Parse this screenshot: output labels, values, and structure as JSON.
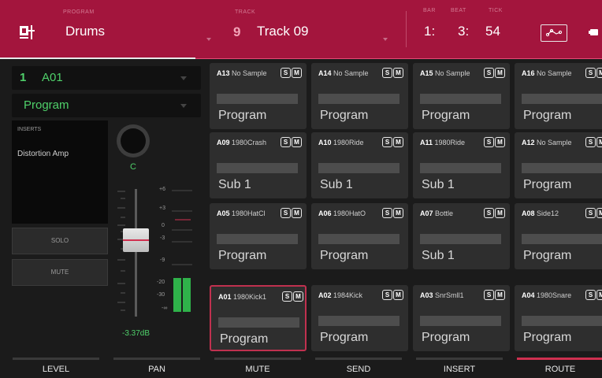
{
  "header": {
    "program_label": "PROGRAM",
    "program_name": "Drums",
    "track_label": "TRACK",
    "track_number": "9",
    "track_name": "Track 09",
    "bar_label": "BAR",
    "beat_label": "BEAT",
    "tick_label": "TICK",
    "bar": "1:",
    "beat": "3:",
    "tick": "54"
  },
  "left_panel": {
    "pad_select": {
      "number": "1",
      "name": "A01"
    },
    "mode_select": "Program",
    "inserts_label": "INSERTS",
    "insert_1": "Distortion Amp",
    "pan_value": "C",
    "solo_label": "SOLO",
    "mute_label": "MUTE",
    "fader_scale": [
      "+6",
      "+3",
      "0",
      "-3",
      "-9",
      "-20",
      "-30",
      "-∞"
    ],
    "level_db": "-3.37dB",
    "fader_level_db": -3.37,
    "meter_levels": [
      0.55,
      0.55
    ]
  },
  "pads": [
    {
      "id": "A13",
      "name": "No Sample",
      "type": "Program",
      "s": "S",
      "m": "M"
    },
    {
      "id": "A14",
      "name": "No Sample",
      "type": "Program",
      "s": "S",
      "m": "M"
    },
    {
      "id": "A15",
      "name": "No Sample",
      "type": "Program",
      "s": "S",
      "m": "M"
    },
    {
      "id": "A16",
      "name": "No Sample",
      "type": "Program",
      "s": "S",
      "m": "M"
    },
    {
      "id": "A09",
      "name": "1980Crash",
      "type": "Sub 1",
      "s": "S",
      "m": "M"
    },
    {
      "id": "A10",
      "name": "1980Ride",
      "type": "Sub 1",
      "s": "S",
      "m": "M"
    },
    {
      "id": "A11",
      "name": "1980Ride",
      "type": "Sub 1",
      "s": "S",
      "m": "M"
    },
    {
      "id": "A12",
      "name": "No Sample",
      "type": "Program",
      "s": "S",
      "m": "M"
    },
    {
      "id": "A05",
      "name": "1980HatCl",
      "type": "Program",
      "s": "S",
      "m": "M"
    },
    {
      "id": "A06",
      "name": "1980HatO",
      "type": "Program",
      "s": "S",
      "m": "M"
    },
    {
      "id": "A07",
      "name": "Bottle",
      "type": "Sub 1",
      "s": "S",
      "m": "M"
    },
    {
      "id": "A08",
      "name": "Side12",
      "type": "Program",
      "s": "S",
      "m": "M"
    },
    {
      "id": "A01",
      "name": "1980Kick1",
      "type": "Program",
      "s": "S",
      "m": "M",
      "selected": true
    },
    {
      "id": "A02",
      "name": "1984Kick",
      "type": "Program",
      "s": "S",
      "m": "M"
    },
    {
      "id": "A03",
      "name": "SnrSmll1",
      "type": "Program",
      "s": "S",
      "m": "M"
    },
    {
      "id": "A04",
      "name": "1980Snare",
      "type": "Program",
      "s": "S",
      "m": "M"
    }
  ],
  "tabs": [
    {
      "label": "LEVEL"
    },
    {
      "label": "PAN"
    },
    {
      "label": "MUTE"
    },
    {
      "label": "SEND"
    },
    {
      "label": "INSERT"
    },
    {
      "label": "ROUTE",
      "active": true
    }
  ],
  "colors": {
    "accent": "#a3153d",
    "active_tab": "#d03050",
    "meter": "#2fb24a"
  },
  "icons": {
    "menu": "program-edit-icon",
    "automation": "automation-icon"
  }
}
